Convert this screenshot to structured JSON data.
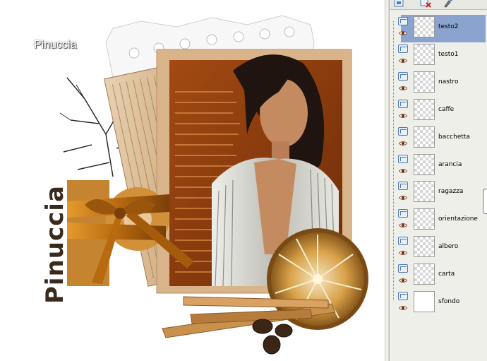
{
  "canvas": {
    "signature": "Pinuccia",
    "vertical_signature": "Pinuccia"
  },
  "layers_panel": {
    "toolbar": [
      {
        "icon": "new-layer-icon"
      },
      {
        "icon": "delete-layer-icon"
      },
      {
        "icon": "brush-icon"
      }
    ],
    "layers": [
      {
        "name": "testo2",
        "selected": true,
        "thumb": "transparent"
      },
      {
        "name": "testo1",
        "selected": false,
        "thumb": "transparent"
      },
      {
        "name": "nastro",
        "selected": false,
        "thumb": "transparent"
      },
      {
        "name": "caffe",
        "selected": false,
        "thumb": "transparent"
      },
      {
        "name": "bacchetta",
        "selected": false,
        "thumb": "transparent"
      },
      {
        "name": "arancia",
        "selected": false,
        "thumb": "transparent"
      },
      {
        "name": "ragazza",
        "selected": false,
        "thumb": "transparent"
      },
      {
        "name": "orientazione",
        "selected": false,
        "thumb": "transparent"
      },
      {
        "name": "albero",
        "selected": false,
        "thumb": "transparent"
      },
      {
        "name": "carta",
        "selected": false,
        "thumb": "transparent"
      },
      {
        "name": "sfondo",
        "selected": false,
        "thumb": "white"
      }
    ],
    "accent_color": "#8aa3cf"
  }
}
